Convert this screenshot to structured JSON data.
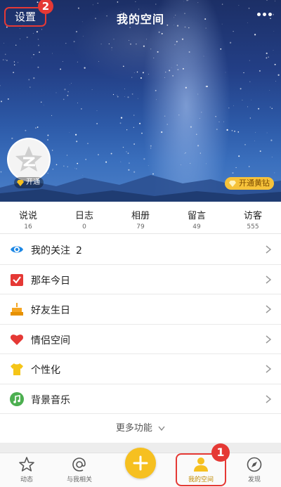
{
  "header": {
    "title": "我的空间",
    "settings_label": "设置",
    "settings_step": "2",
    "more_icon": "more-dots-icon",
    "open_badge": "开通",
    "vip_badge": "开通黄钻"
  },
  "stats": [
    {
      "label": "说说",
      "value": "16"
    },
    {
      "label": "日志",
      "value": "0"
    },
    {
      "label": "相册",
      "value": "79"
    },
    {
      "label": "留言",
      "value": "49"
    },
    {
      "label": "访客",
      "value": "555"
    }
  ],
  "menu": [
    {
      "label": "我的关注",
      "count": "2",
      "icon": "eye-icon",
      "color": "#1e88e5"
    },
    {
      "label": "那年今日",
      "icon": "calendar-check-icon",
      "color": "#e53935"
    },
    {
      "label": "好友生日",
      "icon": "cake-icon",
      "color": "#f5a623"
    },
    {
      "label": "情侣空间",
      "icon": "heart-icon",
      "color": "#e53935"
    },
    {
      "label": "个性化",
      "icon": "tshirt-icon",
      "color": "#f5c518"
    },
    {
      "label": "背景音乐",
      "icon": "music-icon",
      "color": "#4caf50"
    }
  ],
  "more_functions": "更多功能",
  "tabbar": {
    "items": [
      {
        "label": "动态",
        "icon": "star-icon"
      },
      {
        "label": "与我相关",
        "icon": "at-icon"
      },
      {
        "label": "",
        "icon": "plus-icon"
      },
      {
        "label": "我的空间",
        "icon": "person-icon"
      },
      {
        "label": "发现",
        "icon": "compass-icon"
      }
    ],
    "active": "我的空间",
    "active_step": "1"
  },
  "colors": {
    "accent_yellow": "#f6c020",
    "annotation_red": "#e53935",
    "sky_blue": "#2d5aa8"
  }
}
